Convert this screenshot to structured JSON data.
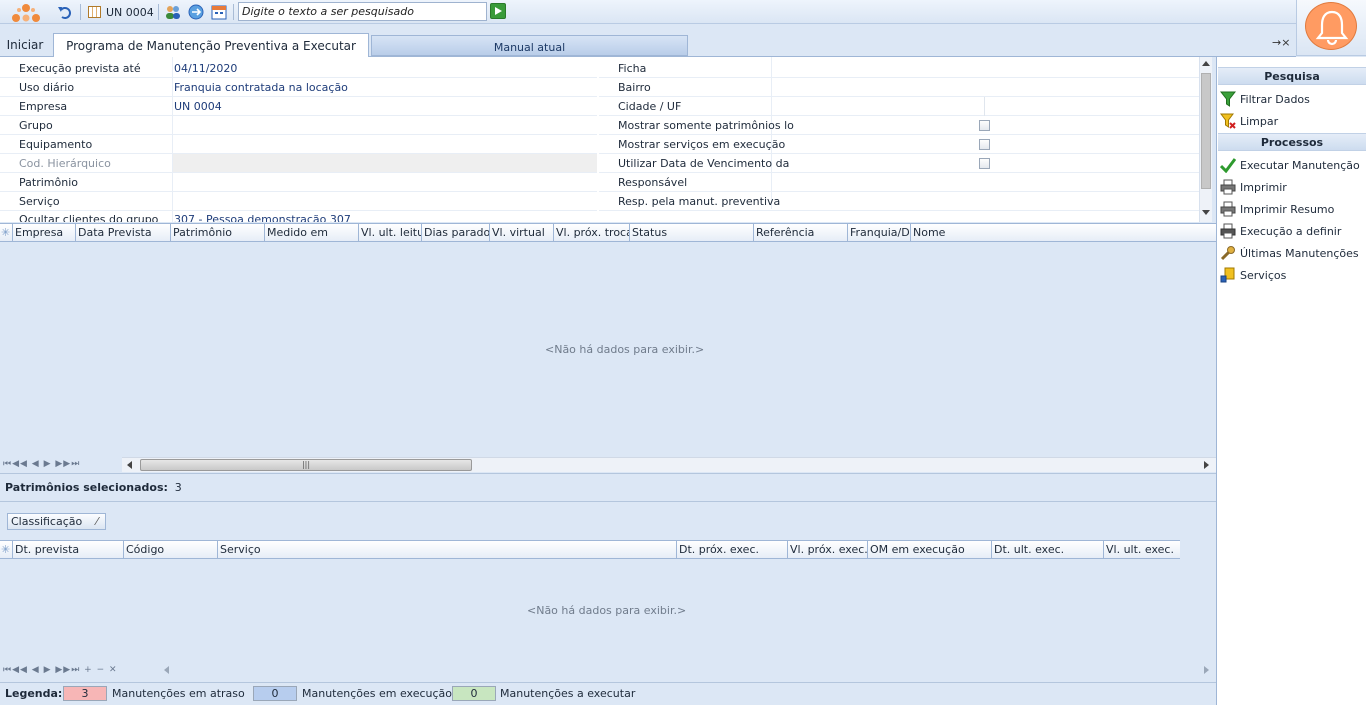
{
  "toolbar": {
    "unit_label": "UN 0004",
    "search_placeholder": "Digite o texto a ser pesquisado"
  },
  "tabs": {
    "home_label": "Iniciar",
    "active_label": "Programa de Manutenção Preventiva a Executar",
    "manual_label": "Manual atual",
    "tools": "→×"
  },
  "form": {
    "left": [
      {
        "label": "Execução prevista até",
        "value": "04/11/2020"
      },
      {
        "label": "Uso diário",
        "value": "Franquia contratada na locação"
      },
      {
        "label": "Empresa",
        "value": "UN 0004"
      },
      {
        "label": "Grupo",
        "value": ""
      },
      {
        "label": "Equipamento",
        "value": ""
      },
      {
        "label": "Cod. Hierárquico",
        "value": ""
      },
      {
        "label": "Patrimônio",
        "value": ""
      },
      {
        "label": "Serviço",
        "value": ""
      },
      {
        "label": "Ocultar clientes do grupo",
        "value": "307 - Pessoa demonstração 307"
      }
    ],
    "right": [
      {
        "label": "Ficha",
        "value": ""
      },
      {
        "label": "Bairro",
        "value": ""
      },
      {
        "label": "Cidade / UF",
        "value": ""
      },
      {
        "label": "Mostrar somente patrimônios lo",
        "value": ""
      },
      {
        "label": "Mostrar serviços em execução",
        "value": ""
      },
      {
        "label": "Utilizar Data de Vencimento da",
        "value": ""
      },
      {
        "label": "Responsável",
        "value": ""
      },
      {
        "label": "Resp. pela manut. preventiva",
        "value": ""
      }
    ]
  },
  "grid1": {
    "columns": [
      "Empresa",
      "Data Prevista",
      "Patrimônio",
      "Medido em",
      "Vl. ult. leitura",
      "Dias parados",
      "Vl. virtual",
      "Vl. próx. troca",
      "Status",
      "Referência",
      "Franquia/Dia",
      "Nome"
    ],
    "empty": "<Não há dados para exibir.>",
    "nav": "⏮◀◀ ◀ ▶ ▶▶⏭"
  },
  "summary": {
    "label": "Patrimônios selecionados:",
    "value": "3"
  },
  "classification": "Classificação",
  "grid2": {
    "columns": [
      "Dt. prevista",
      "Código",
      "Serviço",
      "Dt. próx. exec.",
      "Vl. próx. exec.",
      "OM em execução",
      "Dt. ult. exec.",
      "Vl. ult. exec."
    ],
    "empty": "<Não há dados para exibir.>",
    "nav": "⏮◀◀ ◀ ▶ ▶▶⏭ + − ✕"
  },
  "legend": {
    "title": "Legenda:",
    "items": [
      {
        "count": "3",
        "label": "Manutenções em atraso",
        "color": "#f7b6b6"
      },
      {
        "count": "0",
        "label": "Manutenções em execução",
        "color": "#b7cdee"
      },
      {
        "count": "0",
        "label": "Manutenções a executar",
        "color": "#c8e6c0"
      }
    ]
  },
  "panel": {
    "search_title": "Pesquisa",
    "search_items": [
      "Filtrar Dados",
      "Limpar"
    ],
    "process_title": "Processos",
    "process_items": [
      "Executar Manutenção",
      "Imprimir",
      "Imprimir Resumo",
      "Execução a definir",
      "Últimas Manutenções",
      "Serviços"
    ]
  }
}
